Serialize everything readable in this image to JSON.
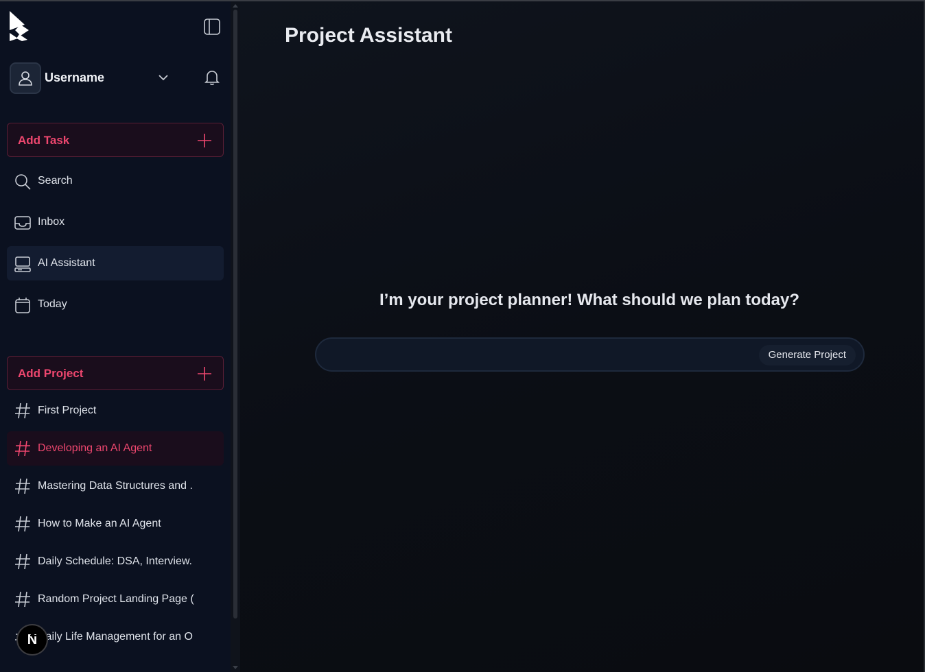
{
  "sidebar": {
    "username": "Username",
    "add_task_label": "Add Task",
    "nav": [
      {
        "label": "Search",
        "icon": "search-icon"
      },
      {
        "label": "Inbox",
        "icon": "inbox-icon"
      },
      {
        "label": "AI Assistant",
        "icon": "computer-icon",
        "active": true
      },
      {
        "label": "Today",
        "icon": "calendar-icon"
      }
    ],
    "add_project_label": "Add Project",
    "projects": [
      {
        "label": "First Project"
      },
      {
        "label": "Developing an AI Agent",
        "active": true
      },
      {
        "label": "Mastering Data Structures and ."
      },
      {
        "label": "How to Make an AI Agent"
      },
      {
        "label": "Daily Schedule: DSA, Interview."
      },
      {
        "label": "Random Project Landing Page ("
      },
      {
        "label": "Daily Life Management for an O"
      }
    ],
    "badge_letter": "N"
  },
  "main": {
    "title": "Project Assistant",
    "prompt": "I’m your project planner! What should we plan today?",
    "input_value": "",
    "input_placeholder": "",
    "generate_label": "Generate Project"
  },
  "colors": {
    "accent": "#ef476f",
    "sidebar_bg": "#0b1120",
    "main_bg": "#0b0e15"
  }
}
